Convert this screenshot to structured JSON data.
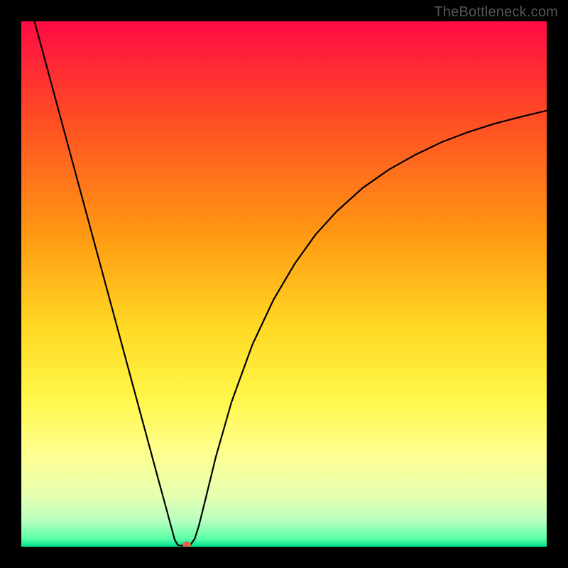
{
  "watermark": "TheBottleneck.com",
  "chart_data": {
    "type": "line",
    "title": "",
    "xlabel": "",
    "ylabel": "",
    "xlim": [
      0,
      100
    ],
    "ylim": [
      0,
      100
    ],
    "background": {
      "type": "vertical-gradient",
      "stops": [
        {
          "pos": 0.0,
          "color": "#ff0b45"
        },
        {
          "pos": 0.18,
          "color": "#ff4b25"
        },
        {
          "pos": 0.4,
          "color": "#ff9713"
        },
        {
          "pos": 0.58,
          "color": "#ffd823"
        },
        {
          "pos": 0.72,
          "color": "#fff74a"
        },
        {
          "pos": 0.82,
          "color": "#ffff90"
        },
        {
          "pos": 0.9,
          "color": "#e8ffb0"
        },
        {
          "pos": 0.95,
          "color": "#b9ffc0"
        },
        {
          "pos": 0.985,
          "color": "#5affa8"
        },
        {
          "pos": 1.0,
          "color": "#00e08c"
        }
      ]
    },
    "series": [
      {
        "name": "curve",
        "stroke": "#000000",
        "stroke_width": 2.2,
        "points": [
          {
            "x": 2.5,
            "y": 100.0
          },
          {
            "x": 4.0,
            "y": 94.5
          },
          {
            "x": 6.0,
            "y": 87.1
          },
          {
            "x": 8.0,
            "y": 79.7
          },
          {
            "x": 10.0,
            "y": 72.3
          },
          {
            "x": 12.0,
            "y": 64.9
          },
          {
            "x": 14.0,
            "y": 57.5
          },
          {
            "x": 16.0,
            "y": 50.1
          },
          {
            "x": 18.0,
            "y": 42.7
          },
          {
            "x": 20.0,
            "y": 35.3
          },
          {
            "x": 22.0,
            "y": 27.9
          },
          {
            "x": 24.0,
            "y": 20.5
          },
          {
            "x": 26.0,
            "y": 13.1
          },
          {
            "x": 27.5,
            "y": 7.6
          },
          {
            "x": 28.5,
            "y": 3.9
          },
          {
            "x": 29.2,
            "y": 1.3
          },
          {
            "x": 29.8,
            "y": 0.3
          },
          {
            "x": 30.5,
            "y": 0.2
          },
          {
            "x": 31.3,
            "y": 0.3
          },
          {
            "x": 32.2,
            "y": 0.35
          },
          {
            "x": 33.0,
            "y": 1.5
          },
          {
            "x": 33.8,
            "y": 4.0
          },
          {
            "x": 35.0,
            "y": 8.8
          },
          {
            "x": 37.0,
            "y": 17.0
          },
          {
            "x": 40.0,
            "y": 27.5
          },
          {
            "x": 44.0,
            "y": 38.5
          },
          {
            "x": 48.0,
            "y": 47.0
          },
          {
            "x": 52.0,
            "y": 53.8
          },
          {
            "x": 56.0,
            "y": 59.4
          },
          {
            "x": 60.0,
            "y": 63.8
          },
          {
            "x": 65.0,
            "y": 68.3
          },
          {
            "x": 70.0,
            "y": 71.8
          },
          {
            "x": 75.0,
            "y": 74.6
          },
          {
            "x": 80.0,
            "y": 77.0
          },
          {
            "x": 85.0,
            "y": 78.9
          },
          {
            "x": 90.0,
            "y": 80.5
          },
          {
            "x": 95.0,
            "y": 81.8
          },
          {
            "x": 100.0,
            "y": 83.0
          }
        ]
      }
    ],
    "marker": {
      "x": 31.5,
      "y": 0.4,
      "rx": 6,
      "ry": 4.5,
      "fill": "#d86a4a"
    }
  }
}
